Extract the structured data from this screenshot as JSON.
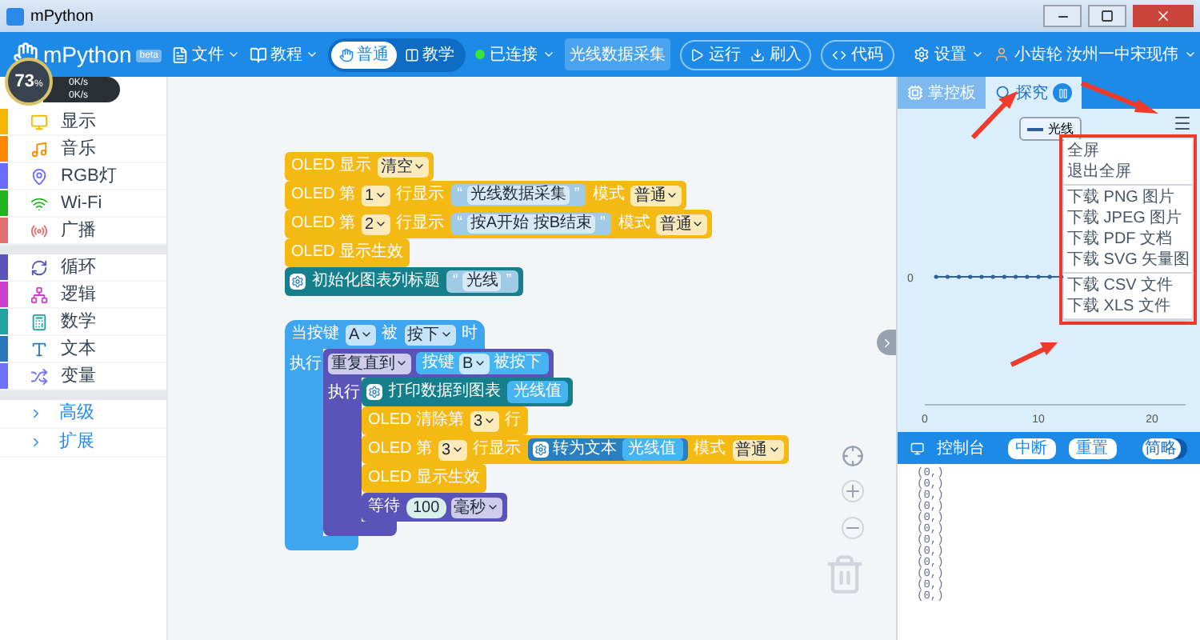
{
  "window": {
    "title": "mPython"
  },
  "toolbar": {
    "logo": "mPython",
    "badge": "beta",
    "menus": [
      "文件",
      "教程"
    ],
    "mode_toggle": [
      {
        "label": "普通",
        "selected": true
      },
      {
        "label": "教学",
        "selected": false
      }
    ],
    "connection": {
      "label": "已连接",
      "connected": true
    },
    "project": "光线数据采集",
    "actions": [
      "运行",
      "刷入"
    ],
    "code": "代码",
    "settings": "设置",
    "user": "小齿轮 汝州一中宋现伟"
  },
  "speed_widget": {
    "percent": "73",
    "unit": "%",
    "upload": "0K/s",
    "download": "0K/s"
  },
  "sidebar": {
    "groups": [
      [
        {
          "label": "显示",
          "color": "#f5b800"
        },
        {
          "label": "音乐",
          "color": "#ff8a00"
        },
        {
          "label": "RGB灯",
          "color": "#6b6bff"
        },
        {
          "label": "Wi-Fi",
          "color": "#1fb51f"
        },
        {
          "label": "广播",
          "color": "#e07070"
        }
      ],
      [
        {
          "label": "循环",
          "color": "#5b54b8"
        },
        {
          "label": "逻辑",
          "color": "#cc3fcc"
        },
        {
          "label": "数学",
          "color": "#1fa39f"
        },
        {
          "label": "文本",
          "color": "#2a78b8"
        },
        {
          "label": "变量",
          "color": "#7070ff"
        }
      ]
    ],
    "links": [
      "高级",
      "扩展"
    ]
  },
  "workspace": {
    "stacks": [
      {
        "kind": "plain",
        "blocks": [
          {
            "kind": "stmt",
            "color": "#f5b914",
            "parts": [
              {
                "kind": "text",
                "v": "OLED 显示"
              },
              {
                "kind": "dd",
                "v": "清空"
              }
            ]
          },
          {
            "kind": "stmt",
            "color": "#f5b914",
            "parts": [
              {
                "kind": "text",
                "v": "OLED 第"
              },
              {
                "kind": "dd",
                "v": "1"
              },
              {
                "kind": "text",
                "v": "行显示"
              },
              {
                "kind": "str",
                "open": "“",
                "v": "光线数据采集",
                "close": "”"
              },
              {
                "kind": "text",
                "v": "模式"
              },
              {
                "kind": "dd",
                "v": "普通"
              }
            ]
          },
          {
            "kind": "stmt",
            "color": "#f5b914",
            "parts": [
              {
                "kind": "text",
                "v": "OLED 第"
              },
              {
                "kind": "dd",
                "v": "2"
              },
              {
                "kind": "text",
                "v": "行显示"
              },
              {
                "kind": "str",
                "open": "“",
                "v": "按A开始 按B结束",
                "close": "”"
              },
              {
                "kind": "text",
                "v": "模式"
              },
              {
                "kind": "dd",
                "v": "普通"
              }
            ]
          },
          {
            "kind": "stmt",
            "color": "#f5b914",
            "parts": [
              {
                "kind": "text",
                "v": "OLED 显示生效"
              }
            ]
          },
          {
            "kind": "stmt",
            "color": "#167f8c",
            "parts": [
              {
                "kind": "gear"
              },
              {
                "kind": "text",
                "v": "初始化图表列标题"
              },
              {
                "kind": "str",
                "open": "“",
                "v": "光线",
                "close": "”"
              }
            ]
          }
        ]
      },
      {
        "kind": "hat",
        "blocks": [
          {
            "kind": "loop",
            "color": "#3ea6ee",
            "parts": [
              {
                "kind": "text",
                "v": "当按键"
              },
              {
                "kind": "dd",
                "v": "A"
              },
              {
                "kind": "text",
                "v": "被"
              },
              {
                "kind": "dd",
                "v": "按下"
              },
              {
                "kind": "text",
                "v": "时"
              }
            ],
            "do": "执行",
            "body": [
              {
                "kind": "loop",
                "color": "#5b54b8",
                "parts": [
                  {
                    "kind": "dd",
                    "v": "重复直到"
                  },
                  {
                    "kind": "block",
                    "color": "#45b4f2",
                    "parts": [
                      {
                        "kind": "text",
                        "v": "按键"
                      },
                      {
                        "kind": "dd",
                        "v": "B"
                      },
                      {
                        "kind": "text",
                        "v": "被按下"
                      }
                    ]
                  }
                ],
                "do": "执行",
                "body": [
                  {
                    "kind": "stmt",
                    "color": "#167f8c",
                    "parts": [
                      {
                        "kind": "gear"
                      },
                      {
                        "kind": "text",
                        "v": "打印数据到图表"
                      },
                      {
                        "kind": "block",
                        "color": "#45b4f2",
                        "parts": [
                          {
                            "kind": "text",
                            "v": "光线值"
                          }
                        ]
                      }
                    ]
                  },
                  {
                    "kind": "stmt",
                    "color": "#f5b914",
                    "parts": [
                      {
                        "kind": "text",
                        "v": "OLED 清除第"
                      },
                      {
                        "kind": "dd",
                        "v": "3"
                      },
                      {
                        "kind": "text",
                        "v": "行"
                      }
                    ]
                  },
                  {
                    "kind": "stmt",
                    "color": "#f5b914",
                    "parts": [
                      {
                        "kind": "text",
                        "v": "OLED 第"
                      },
                      {
                        "kind": "dd",
                        "v": "3"
                      },
                      {
                        "kind": "text",
                        "v": "行显示"
                      },
                      {
                        "kind": "block",
                        "color": "#2a7fc0",
                        "parts": [
                          {
                            "kind": "gear"
                          },
                          {
                            "kind": "text",
                            "v": "转为文本"
                          },
                          {
                            "kind": "block",
                            "color": "#45b4f2",
                            "parts": [
                              {
                                "kind": "text",
                                "v": "光线值"
                              }
                            ]
                          }
                        ]
                      },
                      {
                        "kind": "text",
                        "v": "模式"
                      },
                      {
                        "kind": "dd",
                        "v": "普通"
                      }
                    ]
                  },
                  {
                    "kind": "stmt",
                    "color": "#f5b914",
                    "parts": [
                      {
                        "kind": "text",
                        "v": "OLED 显示生效"
                      }
                    ]
                  },
                  {
                    "kind": "stmt",
                    "color": "#5b54b8",
                    "parts": [
                      {
                        "kind": "text",
                        "v": "等待"
                      },
                      {
                        "kind": "num",
                        "v": "100"
                      },
                      {
                        "kind": "dd",
                        "v": "毫秒"
                      }
                    ]
                  }
                ]
              }
            ]
          }
        ]
      }
    ]
  },
  "right_panel": {
    "tabs": [
      {
        "label": "掌控板",
        "selected": false
      },
      {
        "label": "探究",
        "selected": true
      }
    ],
    "chart": {
      "legend": "光线",
      "y_tick_label": "0",
      "x_tick_labels": [
        "0",
        "10",
        "20"
      ],
      "menu": [
        [
          "全屏",
          "退出全屏"
        ],
        [
          "下载 PNG 图片",
          "下载 JPEG 图片",
          "下载 PDF 文档",
          "下载 SVG 矢量图"
        ],
        [
          "下载 CSV 文件",
          "下载 XLS 文件"
        ]
      ]
    },
    "console": {
      "title": "控制台",
      "buttons": [
        "中断",
        "重置"
      ],
      "toggle": {
        "label": "简略",
        "on": true
      },
      "lines": [
        "(0,)",
        "(0,)",
        "(0,)",
        "(0,)",
        "(0,)",
        "(0,)",
        "(0,)",
        "(0,)",
        "(0,)",
        "(0,)",
        "(0,)",
        "(0,)"
      ]
    }
  }
}
